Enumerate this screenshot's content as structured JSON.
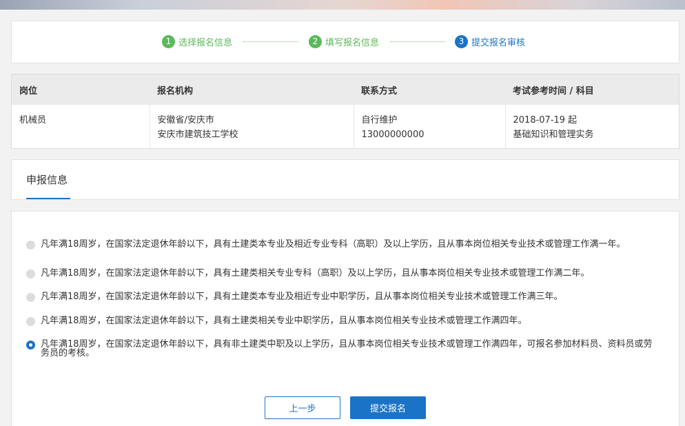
{
  "steps": [
    {
      "num": "1",
      "label": "选择报名信息",
      "state": "done"
    },
    {
      "num": "2",
      "label": "填写报名信息",
      "state": "done"
    },
    {
      "num": "3",
      "label": "提交报名审核",
      "state": "active"
    }
  ],
  "table": {
    "headers": [
      "岗位",
      "报名机构",
      "联系方式",
      "考试参考时间 / 科目"
    ],
    "row": {
      "position": "机械员",
      "org_line1": "安徽省/安庆市",
      "org_line2": "安庆市建筑技工学校",
      "contact_line1": "自行维护",
      "contact_line2": "13000000000",
      "exam_line1": "2018-07-19 起",
      "exam_line2": "基础知识和管理实务"
    }
  },
  "tab": {
    "label": "申报信息"
  },
  "options": [
    {
      "text": "凡年满18周岁，在国家法定退休年龄以下，具有土建类本专业及相近专业专科（高职）及以上学历，且从事本岗位相关专业技术或管理工作满一年。",
      "checked": false
    },
    {
      "text": "凡年满18周岁，在国家法定退休年龄以下，具有土建类相关专业专科（高职）及以上学历，且从事本岗位相关专业技术或管理工作满二年。",
      "checked": false
    },
    {
      "text": "凡年满18周岁，在国家法定退休年龄以下，具有土建类本专业及相近专业中职学历，且从事本岗位相关专业技术或管理工作满三年。",
      "checked": false
    },
    {
      "text": "凡年满18周岁，在国家法定退休年龄以下，具有土建类相关专业中职学历，且从事本岗位相关专业技术或管理工作满四年。",
      "checked": false
    },
    {
      "text": "凡年满18周岁，在国家法定退休年龄以下，具有非土建类中职及以上学历，且从事本岗位相关专业技术或管理工作满四年，可报名参加材料员、资料员或劳务员的考核。",
      "checked": true
    }
  ],
  "buttons": {
    "prev": "上一步",
    "submit": "提交报名"
  },
  "colors": {
    "accent": "#1b73c8",
    "done": "#5cb85c"
  }
}
